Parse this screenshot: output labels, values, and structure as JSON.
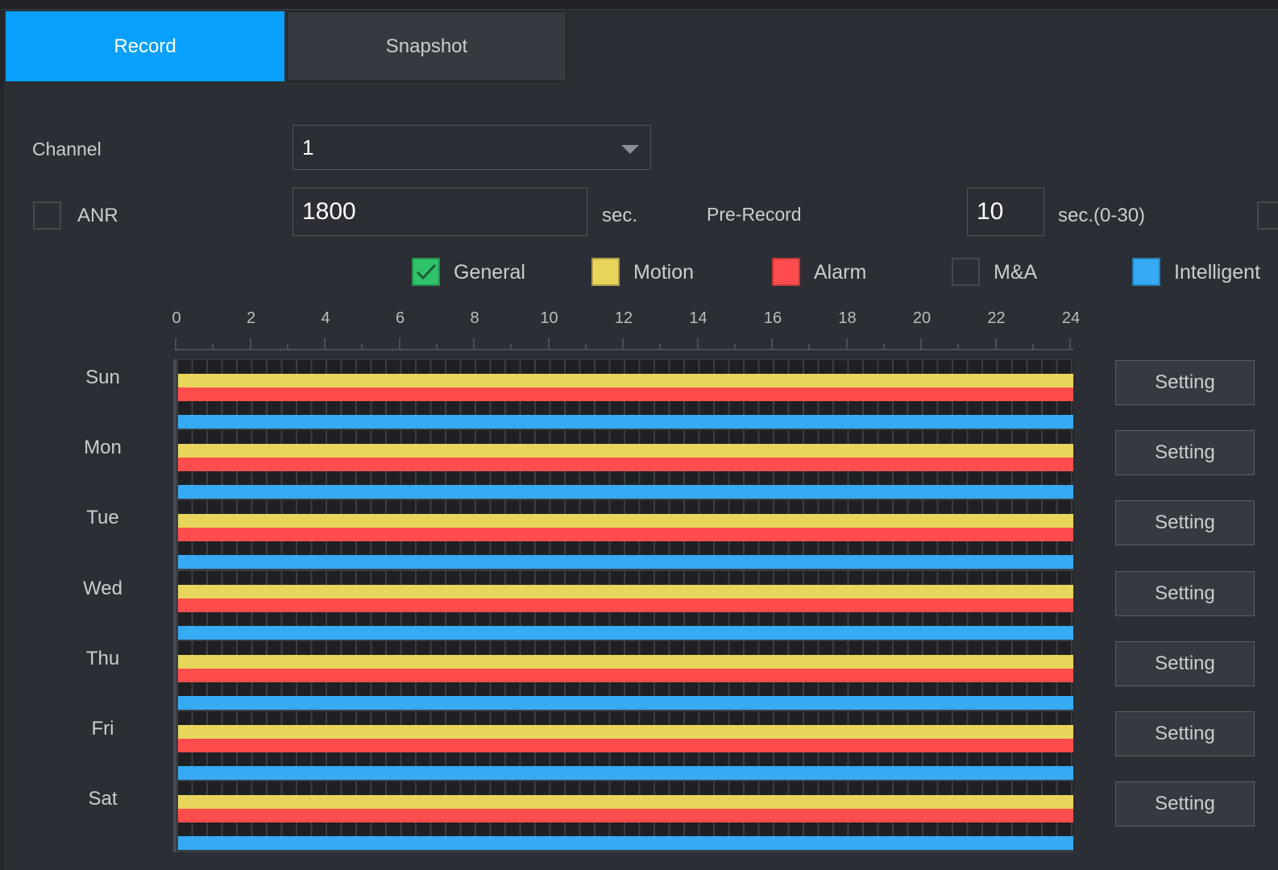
{
  "tabs": [
    {
      "label": "Record",
      "active": true
    },
    {
      "label": "Snapshot",
      "active": false
    }
  ],
  "channel": {
    "label": "Channel",
    "value": "1"
  },
  "anr": {
    "label": "ANR",
    "checked": false,
    "value": "1800",
    "unit": "sec."
  },
  "pre_record": {
    "label": "Pre-Record",
    "value": "10",
    "unit": "sec.(0-30)"
  },
  "legend": [
    {
      "label": "General",
      "color": "#2fc26a",
      "checked": true
    },
    {
      "label": "Motion",
      "color": "#e8d55c",
      "checked": false
    },
    {
      "label": "Alarm",
      "color": "#ff4d4d",
      "checked": false
    },
    {
      "label": "M&A",
      "color": "transparent",
      "checked": false
    },
    {
      "label": "Intelligent",
      "color": "#36aaf3",
      "checked": false
    }
  ],
  "hour_ticks": [
    "0",
    "2",
    "4",
    "6",
    "8",
    "10",
    "12",
    "14",
    "16",
    "18",
    "20",
    "22",
    "24"
  ],
  "setting_label": "Setting",
  "schedule": [
    {
      "day": "Sun",
      "motion": [
        0,
        24
      ],
      "alarm": [
        0,
        24
      ],
      "intelligent": [
        0,
        24
      ]
    },
    {
      "day": "Mon",
      "motion": [
        0,
        24
      ],
      "alarm": [
        0,
        24
      ],
      "intelligent": [
        0,
        24
      ]
    },
    {
      "day": "Tue",
      "motion": [
        0,
        24
      ],
      "alarm": [
        0,
        24
      ],
      "intelligent": [
        0,
        24
      ]
    },
    {
      "day": "Wed",
      "motion": [
        0,
        24
      ],
      "alarm": [
        0,
        24
      ],
      "intelligent": [
        0,
        24
      ]
    },
    {
      "day": "Thu",
      "motion": [
        0,
        24
      ],
      "alarm": [
        0,
        24
      ],
      "intelligent": [
        0,
        24
      ]
    },
    {
      "day": "Fri",
      "motion": [
        0,
        24
      ],
      "alarm": [
        0,
        24
      ],
      "intelligent": [
        0,
        24
      ]
    },
    {
      "day": "Sat",
      "motion": [
        0,
        24
      ],
      "alarm": [
        0,
        24
      ],
      "intelligent": [
        0,
        24
      ]
    }
  ]
}
